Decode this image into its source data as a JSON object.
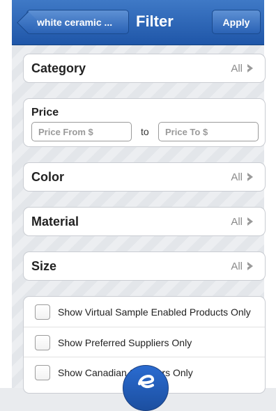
{
  "navbar": {
    "back_label": "white ceramic ...",
    "title": "Filter",
    "apply_label": "Apply"
  },
  "filters": {
    "category": {
      "label": "Category",
      "value": "All"
    },
    "color": {
      "label": "Color",
      "value": "All"
    },
    "material": {
      "label": "Material",
      "value": "All"
    },
    "size": {
      "label": "Size",
      "value": "All"
    }
  },
  "price": {
    "label": "Price",
    "from_placeholder": "Price From $",
    "to_label": "to",
    "to_placeholder": "Price To $"
  },
  "options": [
    {
      "label": "Show Virtual Sample Enabled Products Only",
      "checked": false
    },
    {
      "label": "Show Preferred Suppliers Only",
      "checked": false
    },
    {
      "label": "Show Canadian Suppliers Only",
      "checked": false
    }
  ],
  "icons": {
    "chevron": "chevron-right-icon",
    "fab": "e-logo-icon"
  },
  "colors": {
    "navbar": "#2a62b5",
    "chevron": "#9a9a9a"
  }
}
